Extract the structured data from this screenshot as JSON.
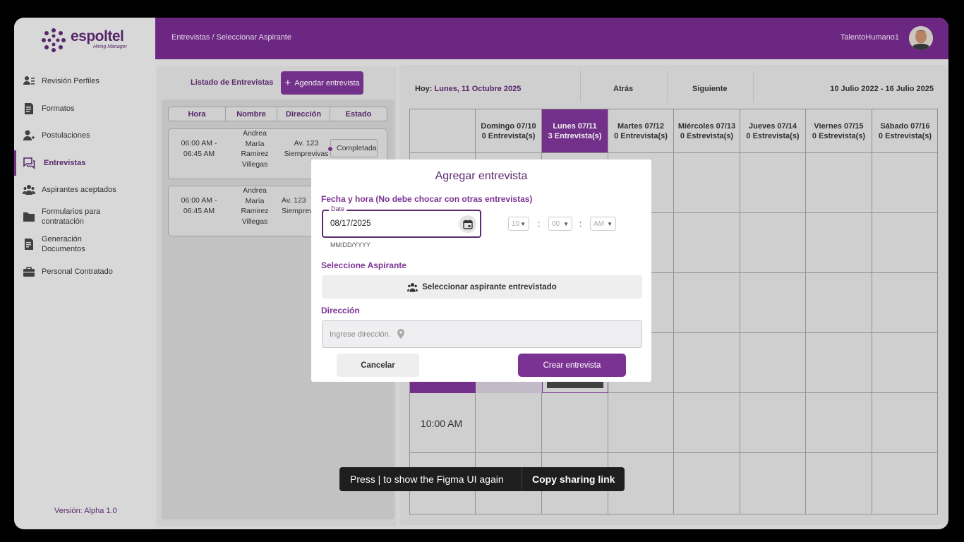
{
  "brand": {
    "name": "espoltel",
    "tagline": "Hiring Manager"
  },
  "sidebar": {
    "items": [
      {
        "label": "Revisión Perfiles",
        "icon": "profile-review-icon"
      },
      {
        "label": "Formatos",
        "icon": "document-icon"
      },
      {
        "label": "Postulaciones",
        "icon": "user-add-icon"
      },
      {
        "label": "Entrevistas",
        "icon": "chat-icon",
        "active": true
      },
      {
        "label": "Aspirantes aceptados",
        "icon": "group-icon"
      },
      {
        "label": "Formularios para contratación",
        "icon": "folder-icon"
      },
      {
        "label": "Generación Documentos",
        "icon": "document-gen-icon"
      },
      {
        "label": "Personal Contratado",
        "icon": "briefcase-icon"
      }
    ],
    "version": "Versión: Alpha 1.0"
  },
  "header": {
    "breadcrumb": "Entrevistas / Seleccionar Aspirante",
    "user": "TalentoHumano1"
  },
  "left": {
    "tab_label": "Listado de Entrevistas",
    "schedule_button": "Agendar entrevista",
    "columns": [
      "Hora",
      "Nombre",
      "Dirección",
      "Estado"
    ],
    "rows": [
      {
        "hora1": "06:00 AM -",
        "hora2": "06:45 AM",
        "n1": "Andrea",
        "n2": "María",
        "n3": "Ramirez",
        "n4": "Villegas",
        "d1": "Av. 123",
        "d2": "Siemprevivas",
        "estado": "Completada"
      },
      {
        "hora1": "06:00 AM -",
        "hora2": "06:45 AM",
        "n1": "Andrea",
        "n2": "María",
        "n3": "Ramirez",
        "n4": "Villegas",
        "d1": "Av. 123",
        "d2": "Siemprevivas",
        "estado": ""
      }
    ]
  },
  "calendar": {
    "today_prefix": "Hoy:",
    "today": "Lunes, 11 Octubre 2025",
    "prev": "Atrás",
    "next": "Siguiente",
    "range": "10 Julio 2022 - 16 Julio 2025",
    "days": [
      {
        "name": "Domingo 07/10",
        "count": "0 Entrevista(s)"
      },
      {
        "name": "Lunes 07/11",
        "count": "3 Entrevista(s)",
        "today": true
      },
      {
        "name": "Martes 07/12",
        "count": "0 Entrevista(s)"
      },
      {
        "name": "Miércoles 07/13",
        "count": "0 Estrevista(s)"
      },
      {
        "name": "Jueves 07/14",
        "count": "0 Estrevista(s)"
      },
      {
        "name": "Viernes 07/15",
        "count": "0 Estrevista(s)"
      },
      {
        "name": "Sábado 07/16",
        "count": "0 Estrevista(s)"
      }
    ],
    "time_label": "10:00 AM"
  },
  "modal": {
    "title": "Agregar entrevista",
    "datetime_label": "Fecha y hora (No debe chocar con otras entrevistas)",
    "date_legend": "Date",
    "date_value": "08/17/2025",
    "date_helper": "MM/DD/YYYY",
    "hour": "10",
    "minute": "00",
    "ampm": "AM",
    "aspirant_label": "Seleccione Aspirante",
    "aspirant_button": "Seleccionar aspirante entrevistado",
    "address_label": "Dirección",
    "address_placeholder": "Ingrese dirección.",
    "cancel": "Cancelar",
    "create": "Crear  entrevista"
  },
  "toast": {
    "message": "Press | to show the Figma UI again",
    "action": "Copy sharing link"
  },
  "colors": {
    "primary": "#732a8c",
    "accent": "#7b3393",
    "panel": "#dcdcdc"
  }
}
